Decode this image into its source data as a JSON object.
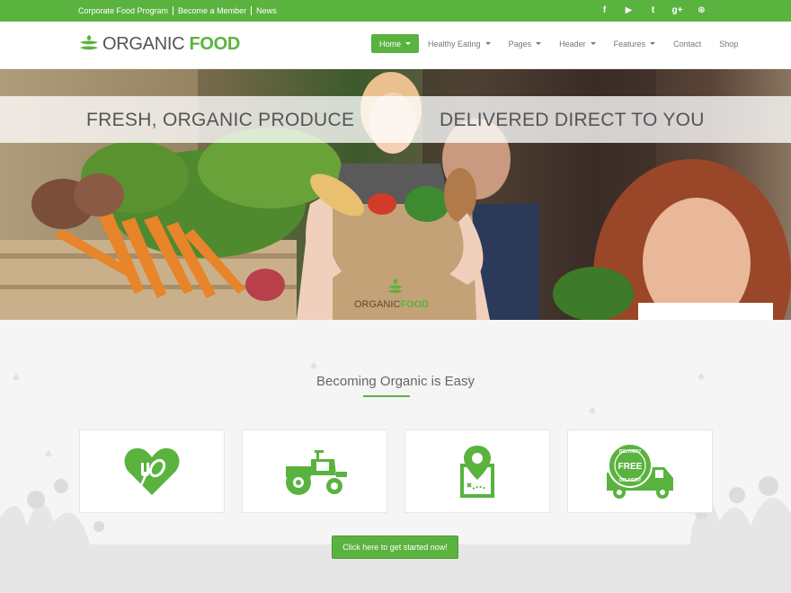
{
  "topbar": {
    "links": [
      "Corporate Food Program",
      "Become a Member",
      "News"
    ],
    "social": [
      "facebook-icon",
      "youtube-icon",
      "twitter-icon",
      "google-plus-icon",
      "dribbble-icon"
    ],
    "social_glyphs": [
      "f",
      "▶",
      "t",
      "g+",
      "⊛"
    ]
  },
  "header": {
    "logo_part1": "ORGANIC ",
    "logo_part2": "FOOD",
    "nav": [
      {
        "label": "Home",
        "caret": true,
        "active": true
      },
      {
        "label": "Healthy Eating",
        "caret": true
      },
      {
        "label": "Pages",
        "caret": true
      },
      {
        "label": "Header",
        "caret": true
      },
      {
        "label": "Features",
        "caret": true
      },
      {
        "label": "Contact",
        "caret": false
      },
      {
        "label": "Shop",
        "caret": false
      }
    ]
  },
  "hero": {
    "left_text": "FRESH, ORGANIC PRODUCE",
    "right_text": "DELIVERED DIRECT TO YOU",
    "bag_logo_1": "ORGANIC",
    "bag_logo_2": "FOOD"
  },
  "features": {
    "title": "Becoming Organic is Easy",
    "cards": [
      "heart-food-icon",
      "tractor-icon",
      "map-pin-icon",
      "delivery-truck-icon"
    ],
    "delivery_badge": "FREE",
    "delivery_ring": "DELIVERY",
    "cta": "Click here to get started now!"
  },
  "colors": {
    "accent": "#5ab33f"
  }
}
